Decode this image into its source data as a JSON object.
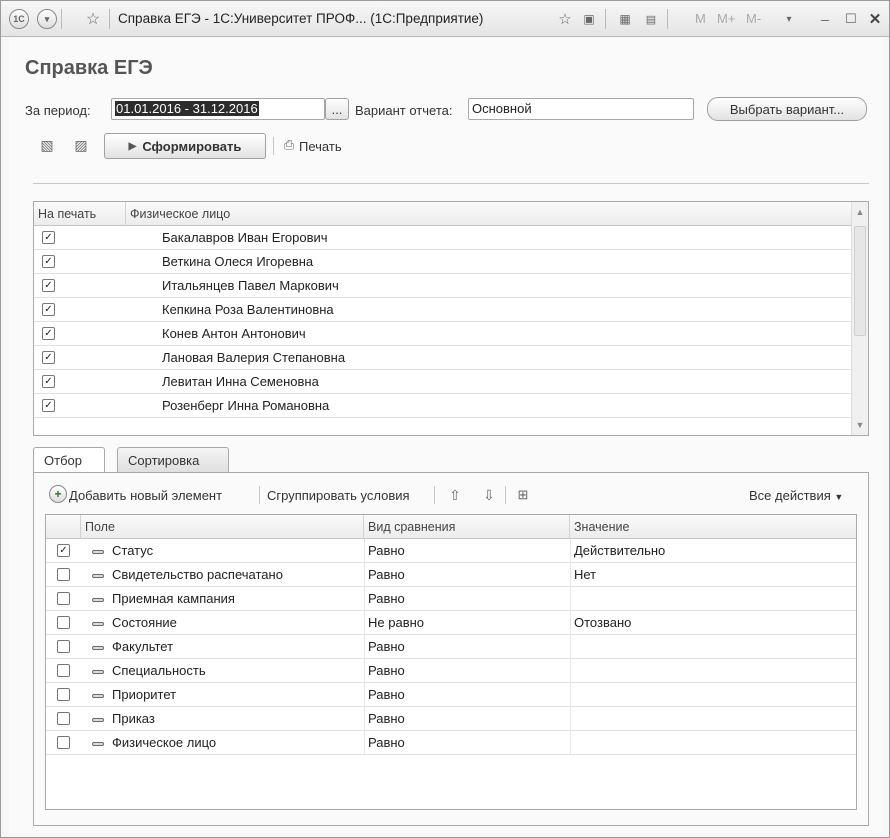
{
  "window": {
    "title": "Справка ЕГЭ - 1С:Университет ПРОФ... (1С:Предприятие)",
    "mem_buttons": [
      "M",
      "M+",
      "M-"
    ]
  },
  "form": {
    "title": "Справка ЕГЭ",
    "period_label": "За период:",
    "period_value": "01.01.2016 - 31.12.2016",
    "period_button": "...",
    "variant_label": "Вариант отчета:",
    "variant_value": "Основной",
    "choose_variant_button": "Выбрать вариант...",
    "generate_button": "Сформировать",
    "print_button": "Печать"
  },
  "persons_table": {
    "columns": [
      "На печать",
      "Физическое лицо"
    ],
    "rows": [
      {
        "checked": true,
        "name": "Бакалавров Иван Егорович"
      },
      {
        "checked": true,
        "name": "Веткина Олеся Игоревна"
      },
      {
        "checked": true,
        "name": "Итальянцев Павел Маркович"
      },
      {
        "checked": true,
        "name": "Кепкина Роза Валентиновна"
      },
      {
        "checked": true,
        "name": "Конев Антон Антонович"
      },
      {
        "checked": true,
        "name": "Лановая Валерия Степановна"
      },
      {
        "checked": true,
        "name": "Левитан Инна Семеновна"
      },
      {
        "checked": true,
        "name": "Розенберг Инна Романовна"
      }
    ]
  },
  "tabs": [
    "Отбор",
    "Сортировка"
  ],
  "filter_toolbar": {
    "add_label": "Добавить новый элемент",
    "group_label": "Сгруппировать условия",
    "all_actions": "Все действия"
  },
  "filter_table": {
    "columns": [
      "Поле",
      "Вид сравнения",
      "Значение"
    ],
    "rows": [
      {
        "checked": true,
        "field": "Статус",
        "comparison": "Равно",
        "value": "Действительно"
      },
      {
        "checked": false,
        "field": "Свидетельство распечатано",
        "comparison": "Равно",
        "value": "Нет"
      },
      {
        "checked": false,
        "field": "Приемная кампания",
        "comparison": "Равно",
        "value": ""
      },
      {
        "checked": false,
        "field": "Состояние",
        "comparison": "Не равно",
        "value": "Отозвано"
      },
      {
        "checked": false,
        "field": "Факультет",
        "comparison": "Равно",
        "value": ""
      },
      {
        "checked": false,
        "field": "Специальность",
        "comparison": "Равно",
        "value": ""
      },
      {
        "checked": false,
        "field": "Приоритет",
        "comparison": "Равно",
        "value": ""
      },
      {
        "checked": false,
        "field": "Приказ",
        "comparison": "Равно",
        "value": ""
      },
      {
        "checked": false,
        "field": "Физическое лицо",
        "comparison": "Равно",
        "value": ""
      }
    ]
  }
}
